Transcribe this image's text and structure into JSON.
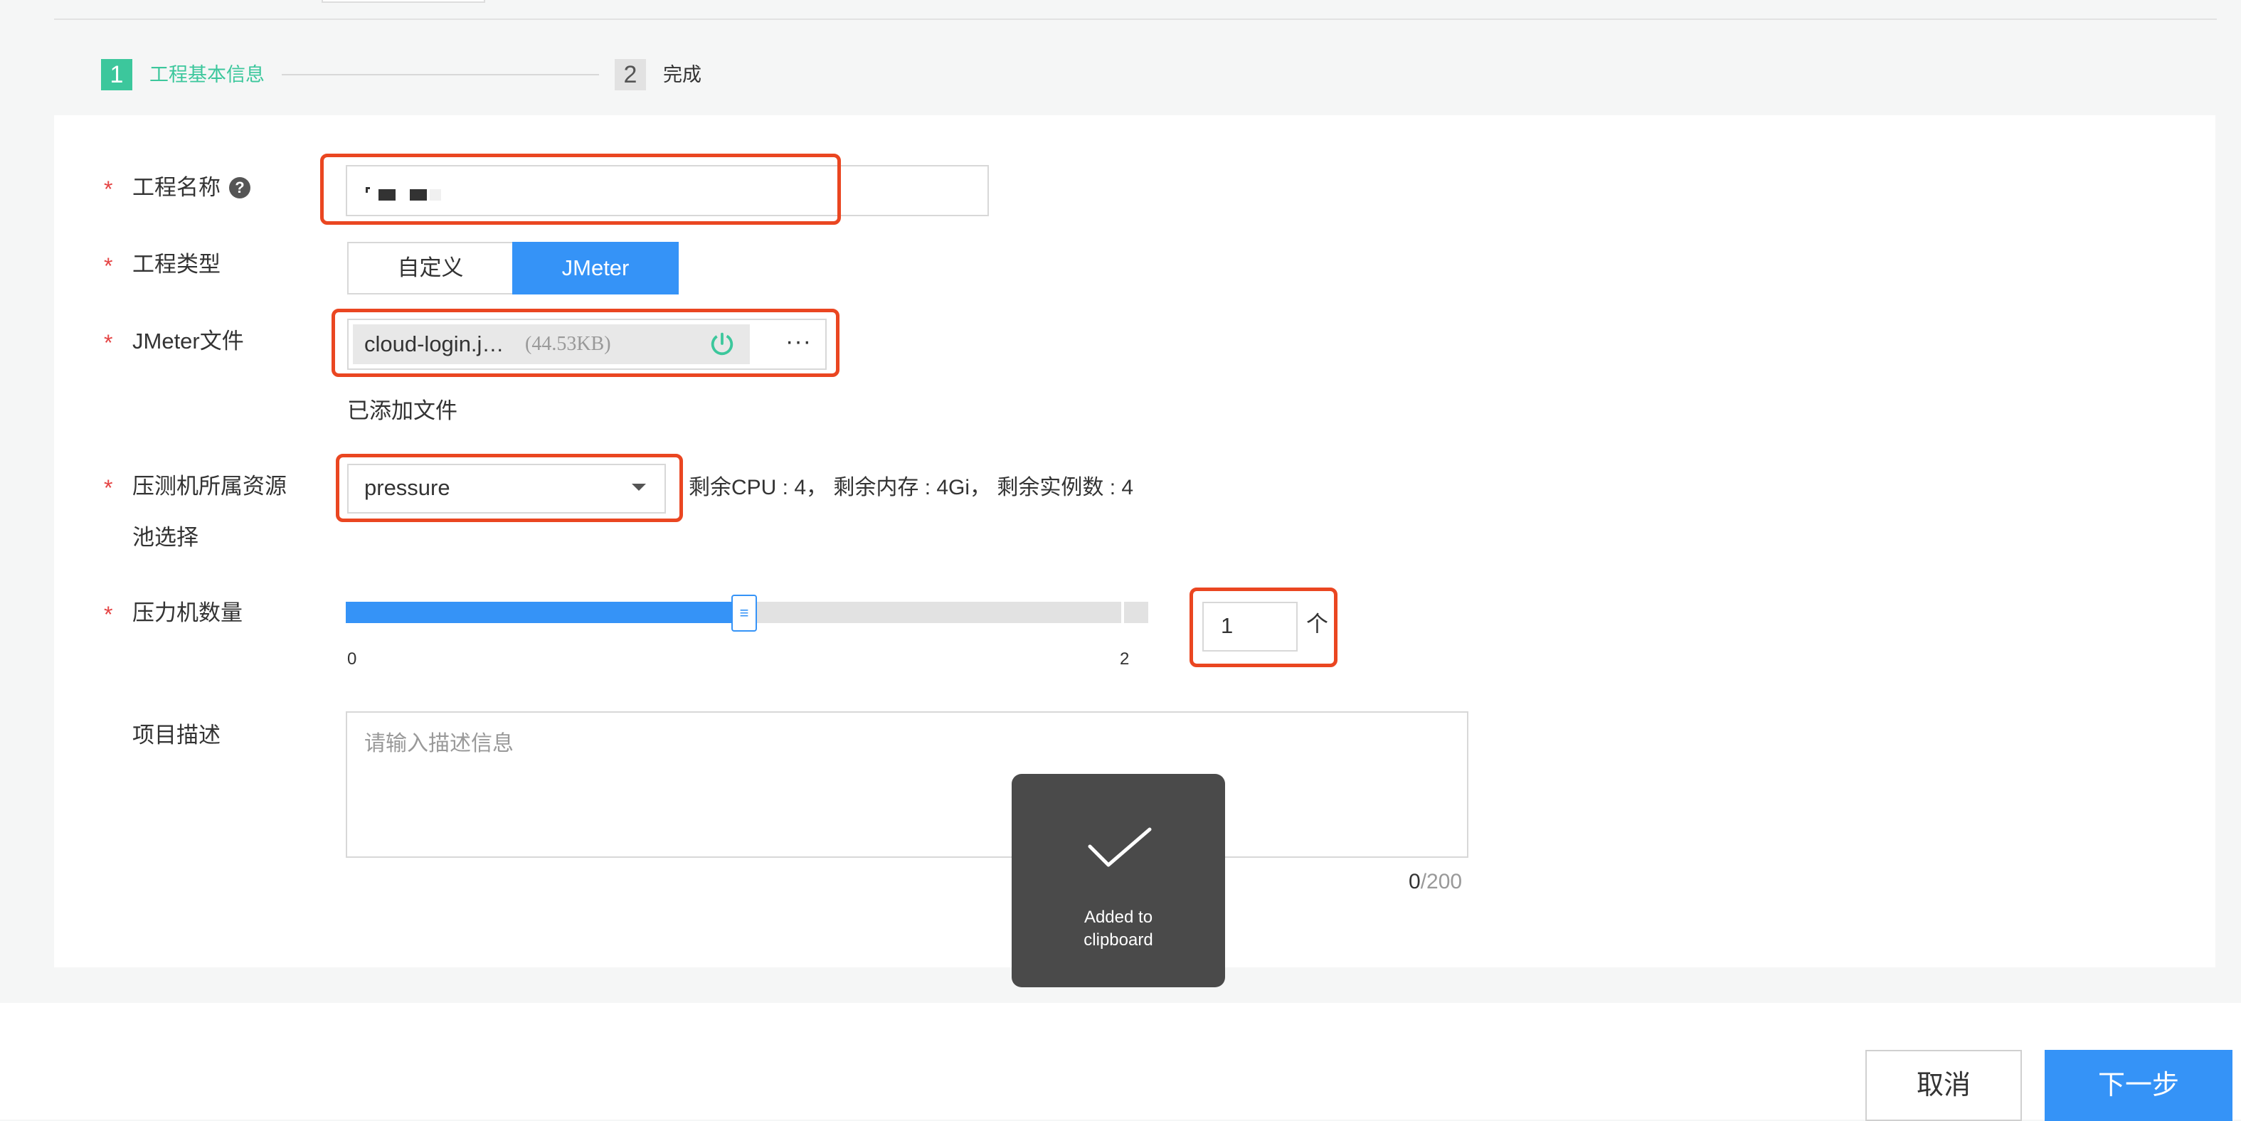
{
  "steps": [
    {
      "number": "1",
      "label": "工程基本信息"
    },
    {
      "number": "2",
      "label": "完成"
    }
  ],
  "colors": {
    "accent": "#3593f7",
    "step_active": "#3cc79c",
    "required": "#e54545",
    "highlight": "#ea4621"
  },
  "form": {
    "project_name": {
      "required": "*",
      "label": "工程名称",
      "help_icon": "question-circle-icon",
      "help_glyph": "?"
    },
    "project_type": {
      "required": "*",
      "label": "工程类型",
      "options": [
        "自定义",
        "JMeter"
      ],
      "selected": "JMeter"
    },
    "jmeter_file": {
      "required": "*",
      "label": "JMeter文件",
      "file_name": "cloud-login.j…",
      "file_size": "(44.53KB)",
      "status_icon": "power-icon",
      "more": "···",
      "added_text": "已添加文件"
    },
    "resource_pool": {
      "required": "*",
      "label_line1": "压测机所属资源",
      "label_line2": "池选择",
      "selected": "pressure",
      "resources": "剩余CPU : 4， 剩余内存 : 4Gi， 剩余实例数 : 4"
    },
    "machine_count": {
      "required": "*",
      "label": "压力机数量",
      "min": "0",
      "max": "2",
      "value": "1",
      "unit": "个",
      "slider_fraction": 0.5
    },
    "description": {
      "label": "项目描述",
      "placeholder": "请输入描述信息",
      "count": "0",
      "limit": "/200"
    }
  },
  "footer": {
    "cancel": "取消",
    "next": "下一步"
  },
  "toast": {
    "icon": "check-icon",
    "text_line1": "Added to",
    "text_line2": "clipboard"
  }
}
